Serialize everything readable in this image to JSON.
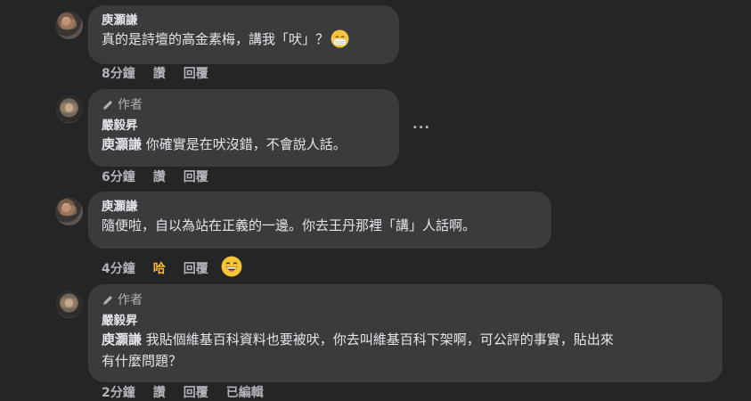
{
  "comments": [
    {
      "name": "庾灝謙",
      "text": "真的是詩壇的高金素梅，講我「吠」？",
      "emoji": "smiling-face-with-medical-mask",
      "time": "8分鐘",
      "like": "讚",
      "reply": "回覆"
    },
    {
      "badge": "作者",
      "name": "嚴毅昇",
      "mention": "庾灝謙",
      "text": " 你確實是在吠沒錯，不會說人話。",
      "time": "6分鐘",
      "like": "讚",
      "reply": "回覆",
      "more": "···"
    },
    {
      "name": "庾灝謙",
      "text": "隨便啦，自以為站在正義的一邊。你去王丹那裡「講」人話啊。",
      "time": "4分鐘",
      "like": "哈",
      "reply": "回覆",
      "reaction": "grinning-face-with-tongue"
    },
    {
      "badge": "作者",
      "name": "嚴毅昇",
      "mention": "庾灝謙",
      "text_line1": " 我貼個維基百科資料也要被吠，你去叫維基百科下架啊，可公評的事實，貼出來",
      "text_line2": "有什麼問題？",
      "time": "2分鐘",
      "like": "讚",
      "reply": "回覆",
      "edited": "已編輯"
    }
  ]
}
